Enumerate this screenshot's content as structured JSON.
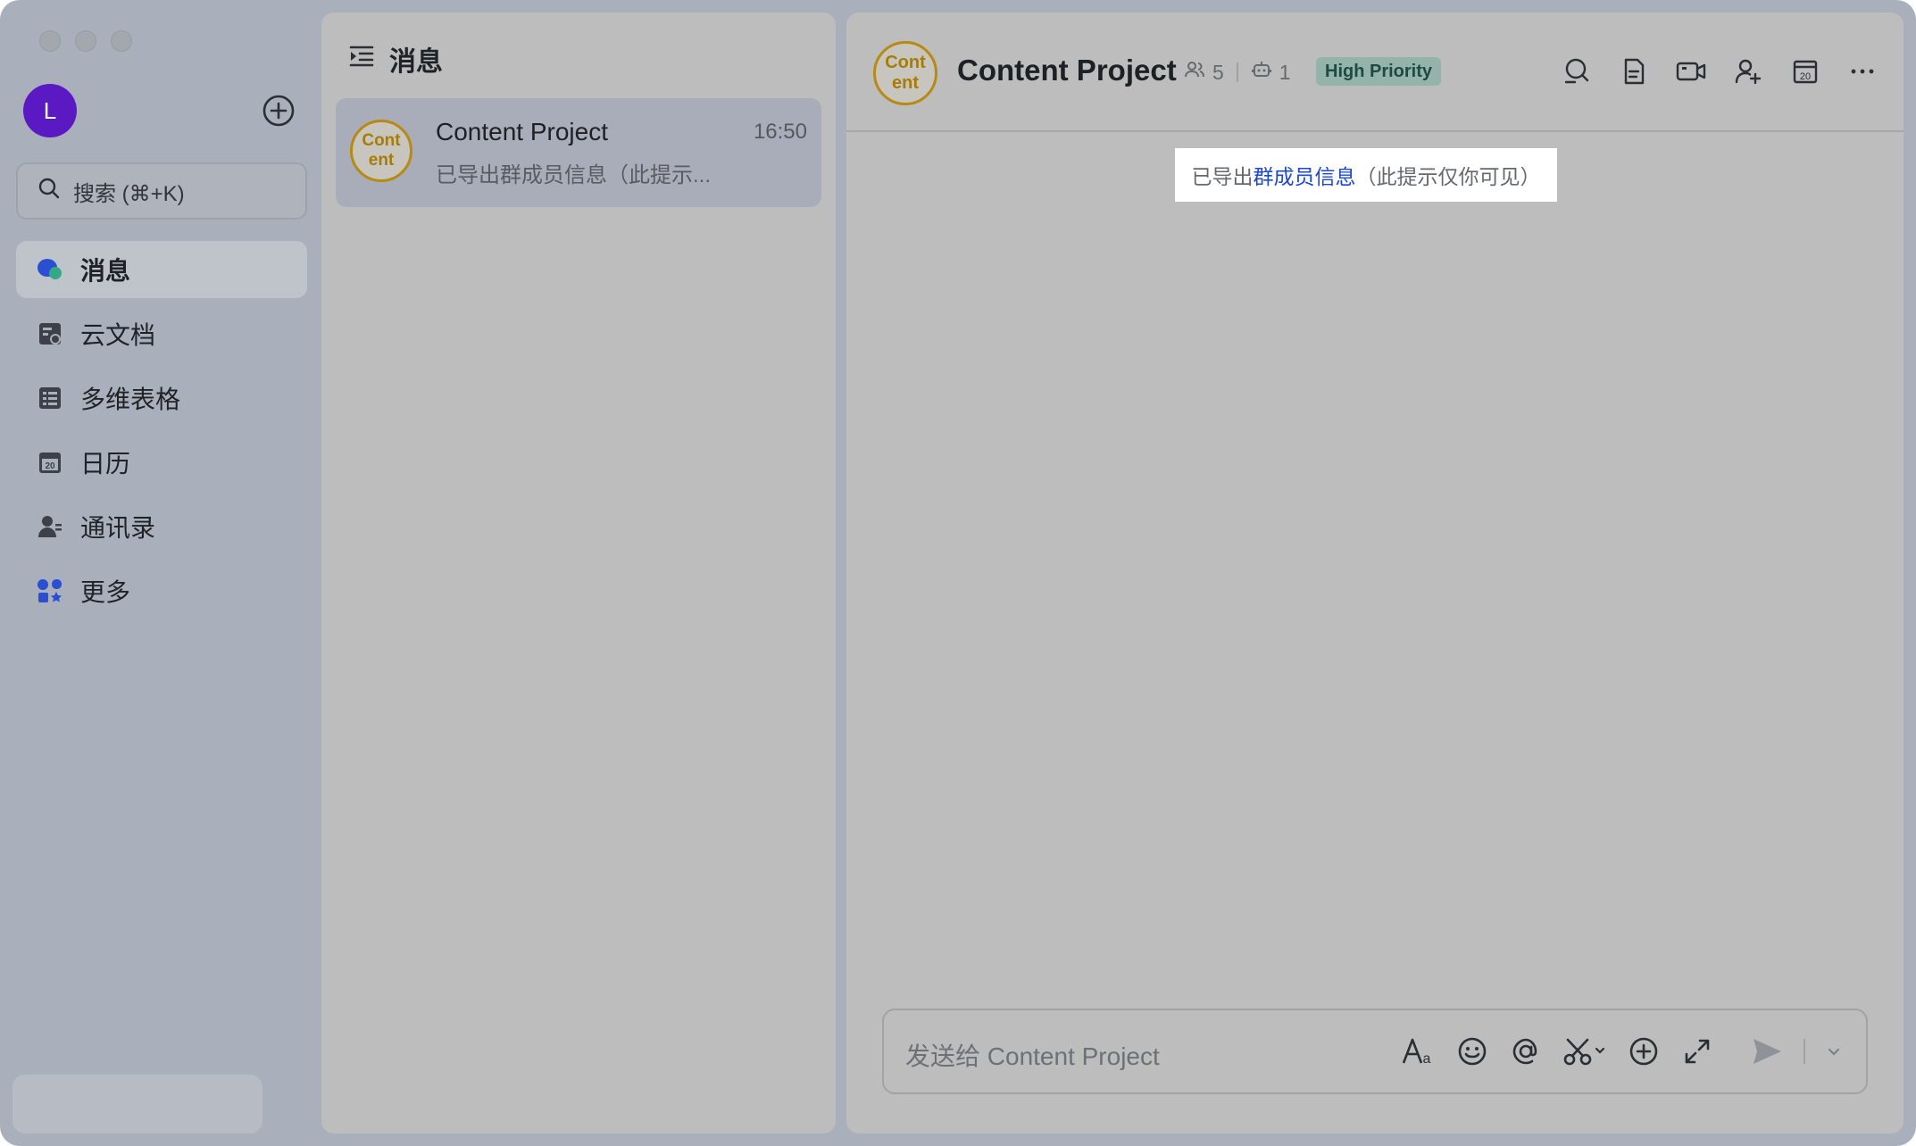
{
  "sidebar": {
    "avatar_letter": "L",
    "search_placeholder": "搜索 (⌘+K)",
    "nav": [
      {
        "label": "消息",
        "icon": "chat-bubbles-icon",
        "active": true
      },
      {
        "label": "云文档",
        "icon": "cloud-doc-icon"
      },
      {
        "label": "多维表格",
        "icon": "table-icon"
      },
      {
        "label": "日历",
        "icon": "calendar-icon"
      },
      {
        "label": "通讯录",
        "icon": "contacts-icon"
      },
      {
        "label": "更多",
        "icon": "apps-grid-icon"
      }
    ]
  },
  "messages_panel": {
    "title": "消息",
    "conversation": {
      "avatar_line1": "Cont",
      "avatar_line2": "ent",
      "title": "Content Project",
      "time": "16:50",
      "preview": "已导出群成员信息（此提示..."
    }
  },
  "chat": {
    "avatar_line1": "Cont",
    "avatar_line2": "ent",
    "title": "Content Project",
    "members_count": "5",
    "bots_count": "1",
    "priority_badge": "High Priority",
    "tools": [
      "search-icon",
      "document-icon",
      "video-call-icon",
      "add-member-icon",
      "calendar-icon",
      "more-icon"
    ],
    "notice": {
      "prefix": "已导出",
      "link": "群成员信息",
      "suffix": "（此提示仅你可见）"
    },
    "composer_placeholder": "发送给 Content Project"
  },
  "colors": {
    "accent_link": "#1d47d6",
    "avatar_purple": "#5b19c4",
    "group_avatar_gold": "#b68a13",
    "badge_bg": "#93b3ab"
  }
}
